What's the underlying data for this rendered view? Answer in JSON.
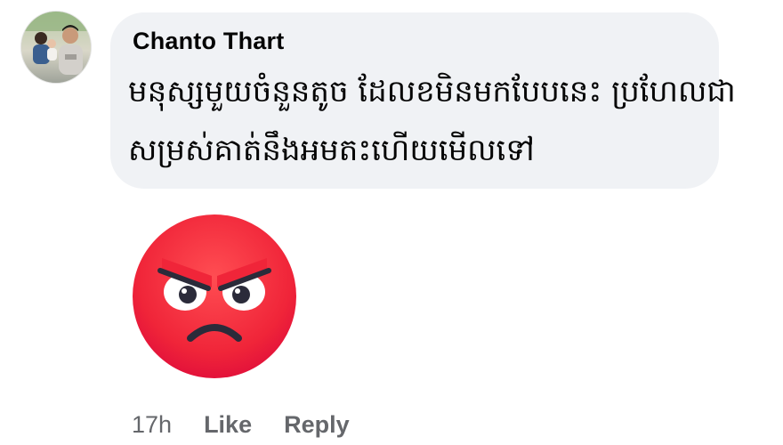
{
  "comment": {
    "author": "Chanto Thart",
    "text_lines": [
      "មនុស្សមួយចំនួនតូច ដែលខមិនមកបែបនេះ ប្រហែលជា",
      "សម្រស់គាត់នឹងអមតះហើយមើលទៅ"
    ],
    "reaction": "angry-reaction",
    "timestamp": "17h",
    "like_label": "Like",
    "reply_label": "Reply"
  },
  "colors": {
    "bubble_bg": "#f0f2f5",
    "meta_text": "#65676b",
    "angry_face": "#f0243a"
  }
}
